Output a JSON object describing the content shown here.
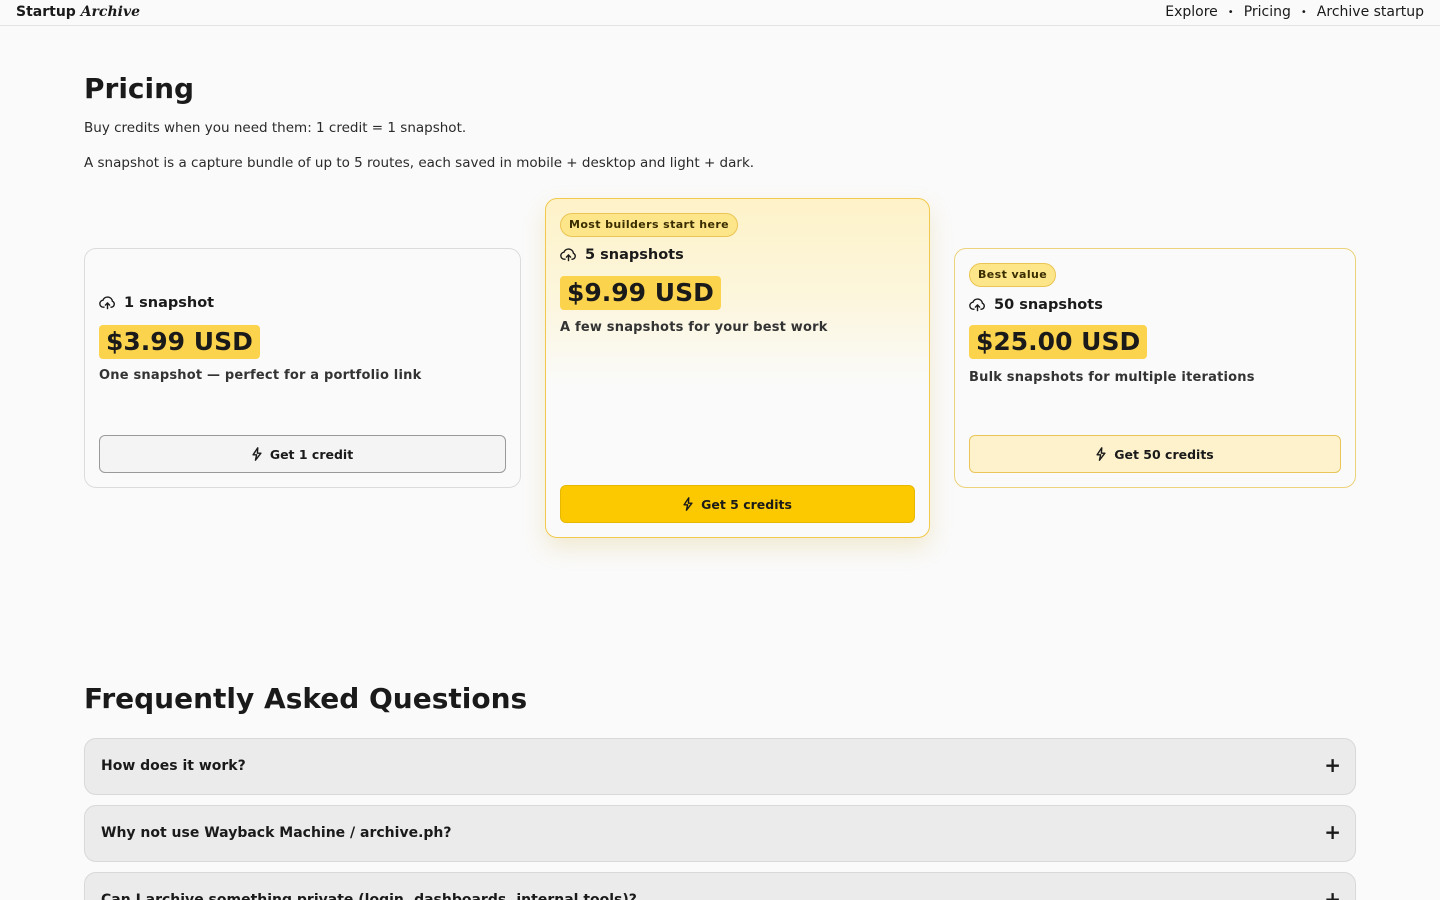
{
  "header": {
    "brand_primary": "Startup",
    "brand_secondary": "Archive",
    "nav": [
      "Explore",
      "Pricing",
      "Archive startup"
    ],
    "separator": "•"
  },
  "page": {
    "title": "Pricing",
    "intro_1": "Buy credits when you need them: 1 credit = 1 snapshot.",
    "intro_2": "A snapshot is a capture bundle of up to 5 routes, each saved in mobile + desktop and light + dark."
  },
  "plans": [
    {
      "badge": "",
      "name": "1 snapshot",
      "price": "$3.99 USD",
      "description": "One snapshot — perfect for a portfolio link",
      "button": "Get 1 credit"
    },
    {
      "badge": "Most builders start here",
      "name": "5 snapshots",
      "price": "$9.99 USD",
      "description": "A few snapshots for your best work",
      "button": "Get 5 credits"
    },
    {
      "badge": "Best value",
      "name": "50 snapshots",
      "price": "$25.00 USD",
      "description": "Bulk snapshots for multiple iterations",
      "button": "Get 50 credits"
    }
  ],
  "faq": {
    "title": "Frequently Asked Questions",
    "items": [
      "How does it work?",
      "Why not use Wayback Machine / archive.ph?",
      "Can I archive something private (login, dashboards, internal tools)?"
    ],
    "toggle": "+"
  },
  "icons": {
    "plan": "cloud-upload-icon",
    "button": "lightning-icon"
  },
  "colors": {
    "accent": "#fcc800",
    "price_highlight": "#fcd34d",
    "badge": "#fde68a"
  }
}
